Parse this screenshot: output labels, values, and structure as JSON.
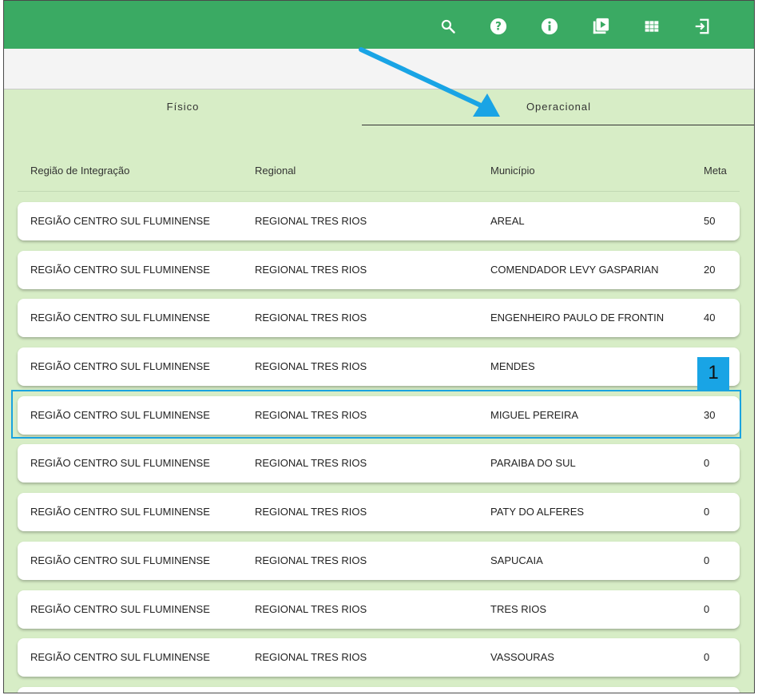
{
  "toolbar": {
    "icons": [
      "search-icon",
      "help-icon",
      "info-icon",
      "video-library-icon",
      "grid-apps-icon",
      "logout-icon"
    ],
    "color": "#3aaa63"
  },
  "tabs": [
    {
      "label": "Físico",
      "active": false
    },
    {
      "label": "Operacional",
      "active": true
    }
  ],
  "table": {
    "columns": [
      "Região de Integração",
      "Regional",
      "Município",
      "Meta"
    ],
    "rows": [
      {
        "regiao": "REGIÃO CENTRO SUL FLUMINENSE",
        "regional": "REGIONAL TRES RIOS",
        "municipio": "AREAL",
        "meta": "50"
      },
      {
        "regiao": "REGIÃO CENTRO SUL FLUMINENSE",
        "regional": "REGIONAL TRES RIOS",
        "municipio": "COMENDADOR LEVY GASPARIAN",
        "meta": "20"
      },
      {
        "regiao": "REGIÃO CENTRO SUL FLUMINENSE",
        "regional": "REGIONAL TRES RIOS",
        "municipio": "ENGENHEIRO PAULO DE FRONTIN",
        "meta": "40"
      },
      {
        "regiao": "REGIÃO CENTRO SUL FLUMINENSE",
        "regional": "REGIONAL TRES RIOS",
        "municipio": "MENDES",
        "meta": ""
      },
      {
        "regiao": "REGIÃO CENTRO SUL FLUMINENSE",
        "regional": "REGIONAL TRES RIOS",
        "municipio": "MIGUEL PEREIRA",
        "meta": "30"
      },
      {
        "regiao": "REGIÃO CENTRO SUL FLUMINENSE",
        "regional": "REGIONAL TRES RIOS",
        "municipio": "PARAIBA DO SUL",
        "meta": "0"
      },
      {
        "regiao": "REGIÃO CENTRO SUL FLUMINENSE",
        "regional": "REGIONAL TRES RIOS",
        "municipio": "PATY DO ALFERES",
        "meta": "0"
      },
      {
        "regiao": "REGIÃO CENTRO SUL FLUMINENSE",
        "regional": "REGIONAL TRES RIOS",
        "municipio": "SAPUCAIA",
        "meta": "0"
      },
      {
        "regiao": "REGIÃO CENTRO SUL FLUMINENSE",
        "regional": "REGIONAL TRES RIOS",
        "municipio": "TRES RIOS",
        "meta": "0"
      },
      {
        "regiao": "REGIÃO CENTRO SUL FLUMINENSE",
        "regional": "REGIONAL TRES RIOS",
        "municipio": "VASSOURAS",
        "meta": "0"
      }
    ]
  },
  "annotation": {
    "badge": "1",
    "color": "#1aa3e0"
  }
}
